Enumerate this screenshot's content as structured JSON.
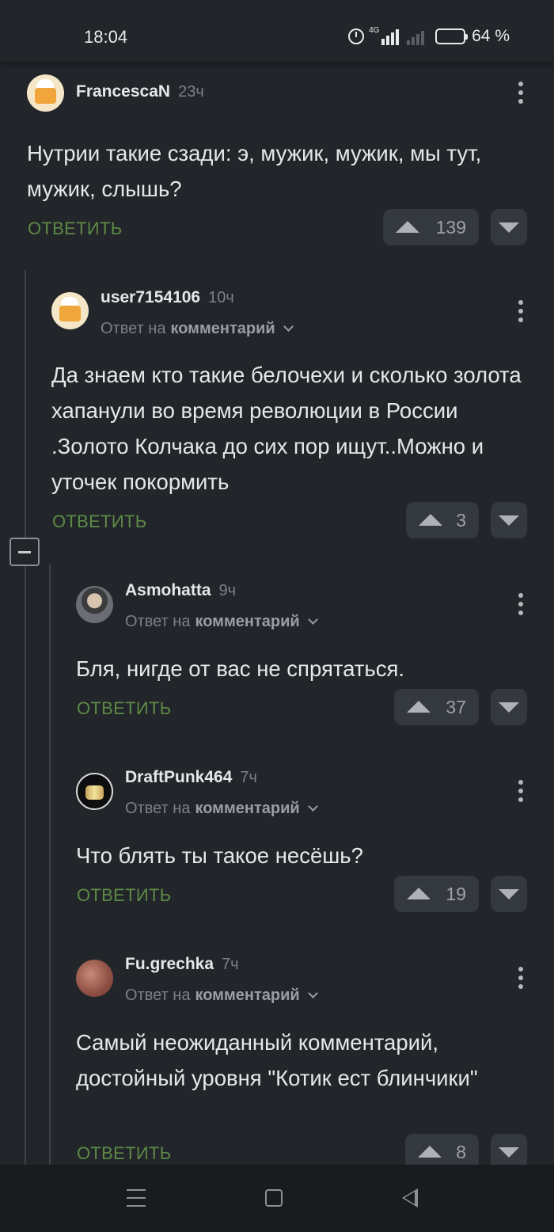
{
  "status_bar": {
    "time": "18:04",
    "network": "4G",
    "battery_text": "64 %",
    "battery_level": 0.64,
    "icons": [
      "alarm-icon",
      "signal-icon",
      "battery-icon"
    ]
  },
  "colors": {
    "background": "#22262b",
    "reply_green": "#5e8a45",
    "battery": "#f2c318"
  },
  "comments": [
    {
      "author": "FrancescaN",
      "time": "23ч",
      "text": "Нутрии такие сзади: э, мужик, мужик, мы тут, мужик, слышь?",
      "reply": "ОТВЕТИТЬ",
      "votes": "139"
    },
    {
      "author": "user7154106",
      "time": "10ч",
      "reply_prefix": "Ответ на",
      "reply_target": "комментарий",
      "text": "Да знаем кто такие белочехи и сколько золота хапанули во время революции в России .Золото Колчака до сих пор ищут..Можно и уточек покормить",
      "reply": "ОТВЕТИТЬ",
      "votes": "3"
    },
    {
      "author": "Asmohatta",
      "time": "9ч",
      "reply_prefix": "Ответ на",
      "reply_target": "комментарий",
      "text": "Бля, нигде от вас не спрятаться.",
      "reply": "ОТВЕТИТЬ",
      "votes": "37"
    },
    {
      "author": "DraftPunk464",
      "time": "7ч",
      "reply_prefix": "Ответ на",
      "reply_target": "комментарий",
      "text": "Что блять ты такое несёшь?",
      "reply": "ОТВЕТИТЬ",
      "votes": "19"
    },
    {
      "author": "Fu.grechka",
      "time": "7ч",
      "reply_prefix": "Ответ на",
      "reply_target": "комментарий",
      "text": "Самый неожиданный комментарий, достойный уровня \"Котик ест блинчики\"",
      "reply": "ОТВЕТИТЬ",
      "votes": "8"
    }
  ]
}
